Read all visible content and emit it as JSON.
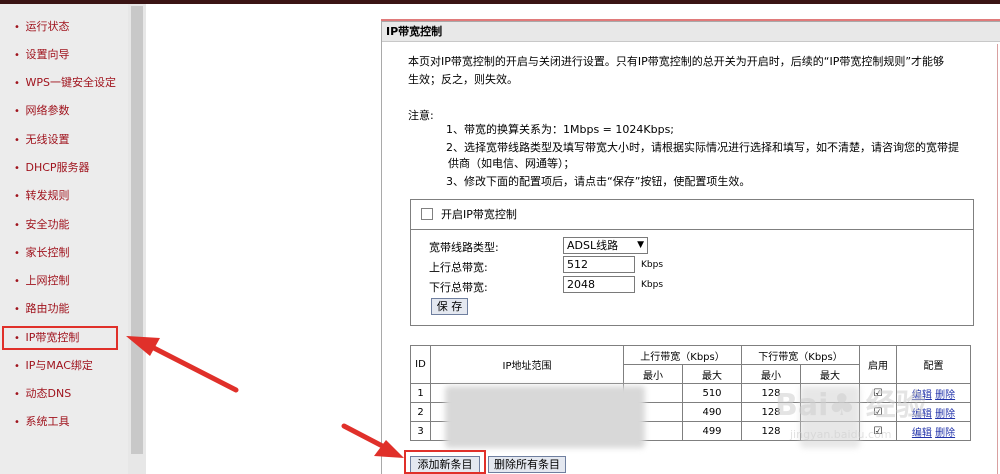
{
  "sidebar": {
    "items": [
      {
        "label": "运行状态"
      },
      {
        "label": "设置向导"
      },
      {
        "label": "WPS一键安全设定"
      },
      {
        "label": "网络参数"
      },
      {
        "label": "无线设置"
      },
      {
        "label": "DHCP服务器"
      },
      {
        "label": "转发规则"
      },
      {
        "label": "安全功能"
      },
      {
        "label": "家长控制"
      },
      {
        "label": "上网控制"
      },
      {
        "label": "路由功能"
      },
      {
        "label": "IP带宽控制"
      },
      {
        "label": "IP与MAC绑定"
      },
      {
        "label": "动态DNS"
      },
      {
        "label": "系统工具"
      }
    ],
    "active": "IP带宽控制"
  },
  "panel": {
    "title": "IP带宽控制",
    "description_1": "本页对IP带宽控制的开启与关闭进行设置。只有IP带宽控制的总开关为开启时，后续的“IP带宽控制规则”才能够",
    "description_2": "生效；反之，则失效。",
    "note_label": "注意:",
    "notes": [
      "1、带宽的换算关系为：1Mbps = 1024Kbps;",
      "2、选择宽带线路类型及填写带宽大小时，请根据实际情况进行选择和填写，如不清楚，请咨询您的宽带提",
      "供商（如电信、网通等）；",
      "3、修改下面的配置项后，请点击“保存”按钮，使配置项生效。"
    ]
  },
  "control": {
    "enable_label": "开启IP带宽控制",
    "enabled": false,
    "line_type_label": "宽带线路类型:",
    "line_type_value": "ADSL线路",
    "up_label": "上行总带宽:",
    "up_value": "512",
    "down_label": "下行总带宽:",
    "down_value": "2048",
    "unit": "Kbps",
    "save_label": "保 存"
  },
  "rules_table": {
    "headers": {
      "id": "ID",
      "ip_range": "IP地址范围",
      "up": "上行带宽（Kbps）",
      "down": "下行带宽（Kbps）",
      "min": "最小",
      "max": "最大",
      "enable": "启用",
      "config": "配置"
    },
    "rows": [
      {
        "id": "1",
        "up_max": "510",
        "down_min": "128",
        "edit": "编辑",
        "delete": "删除"
      },
      {
        "id": "2",
        "up_max": "490",
        "down_min": "128",
        "edit": "编辑",
        "delete": "删除"
      },
      {
        "id": "3",
        "up_max": "499",
        "down_min": "128",
        "edit": "编辑",
        "delete": "删除"
      }
    ]
  },
  "actions": {
    "add_label": "添加新条目",
    "delete_all_label": "删除所有条目"
  },
  "colors": {
    "sidebar_text": "#a0141e",
    "annotation_red": "#e0302a",
    "link": "#2233aa"
  },
  "watermark": {
    "text": "Bai 经验",
    "url": "jingyan.baidu.com"
  }
}
